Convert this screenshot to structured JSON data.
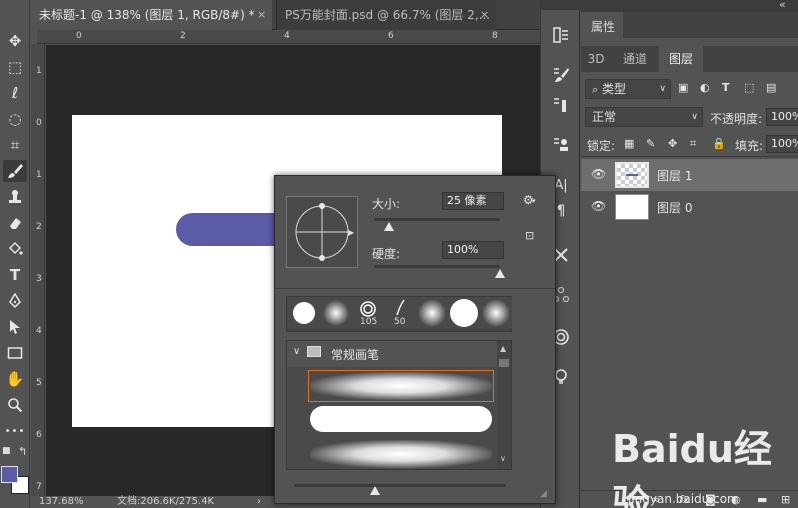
{
  "tabs": {
    "active": "未标题-1 @ 138% (图层 1, RGB/8#) *",
    "inactive": "PS万能封面.psd @ 66.7% (图层 2,...",
    "close": "×"
  },
  "rulers": {
    "h": [
      "0",
      "2",
      "4",
      "6",
      "8"
    ],
    "v": [
      "1",
      "0",
      "1",
      "2",
      "3",
      "4",
      "5",
      "6",
      "7"
    ]
  },
  "status": {
    "zoom": "137.68%",
    "doc": "文档:206.6K/275.4K",
    "arrow": "›"
  },
  "toolbar": {
    "tools": [
      "move-tool",
      "marquee-tool",
      "lasso-tool",
      "quick-select-tool",
      "crop-tool",
      "eyedropper-tool",
      "brush-tool",
      "clone-stamp-tool",
      "eraser-tool",
      "paint-bucket-tool",
      "type-tool",
      "pen-tool",
      "path-select-tool",
      "rectangle-tool",
      "hand-tool",
      "zoom-tool",
      "more-tools"
    ],
    "glyphs": [
      "✥",
      "⬚",
      "ℓ",
      "◌",
      "⌗",
      "✎",
      "🖌",
      "♟",
      "⌫",
      "◈",
      "T",
      "✒",
      "➤",
      "▭",
      "✋",
      "⌕",
      "•••"
    ],
    "more": "•••",
    "swap": "↰"
  },
  "colors": {
    "foreground": "#5b5ba8",
    "background": "#ffffff"
  },
  "mid_icons": [
    "history-icon",
    "brush-settings-icon",
    "adjustments-icon",
    "paragraph-icon",
    "character-icon",
    "tools-icon",
    "3d-icon",
    "channels-icon",
    "light-icon"
  ],
  "props": {
    "title": "属性",
    "collapse": "«"
  },
  "layers_panel": {
    "tabs": [
      "3D",
      "通道",
      "图层"
    ],
    "filter_label": "类型",
    "blend_mode": "正常",
    "opacity_label": "不透明度:",
    "opacity_value": "100%",
    "lock_label": "锁定:",
    "fill_label": "填充:",
    "fill_value": "100%",
    "layers": [
      {
        "name": "图层 1",
        "selected": true
      },
      {
        "name": "图层 0",
        "selected": false
      }
    ]
  },
  "brush_popup": {
    "size_label": "大小:",
    "size_value": "25 像素",
    "hardness_label": "硬度:",
    "hardness_value": "100%",
    "size_fraction": 0.12,
    "hardness_fraction": 1.0,
    "preset_labels": [
      "105",
      "50"
    ],
    "folder_name": "常规画笔"
  },
  "watermark": {
    "logo": "Baidu经验",
    "url": "jingyan.baidu.com"
  }
}
